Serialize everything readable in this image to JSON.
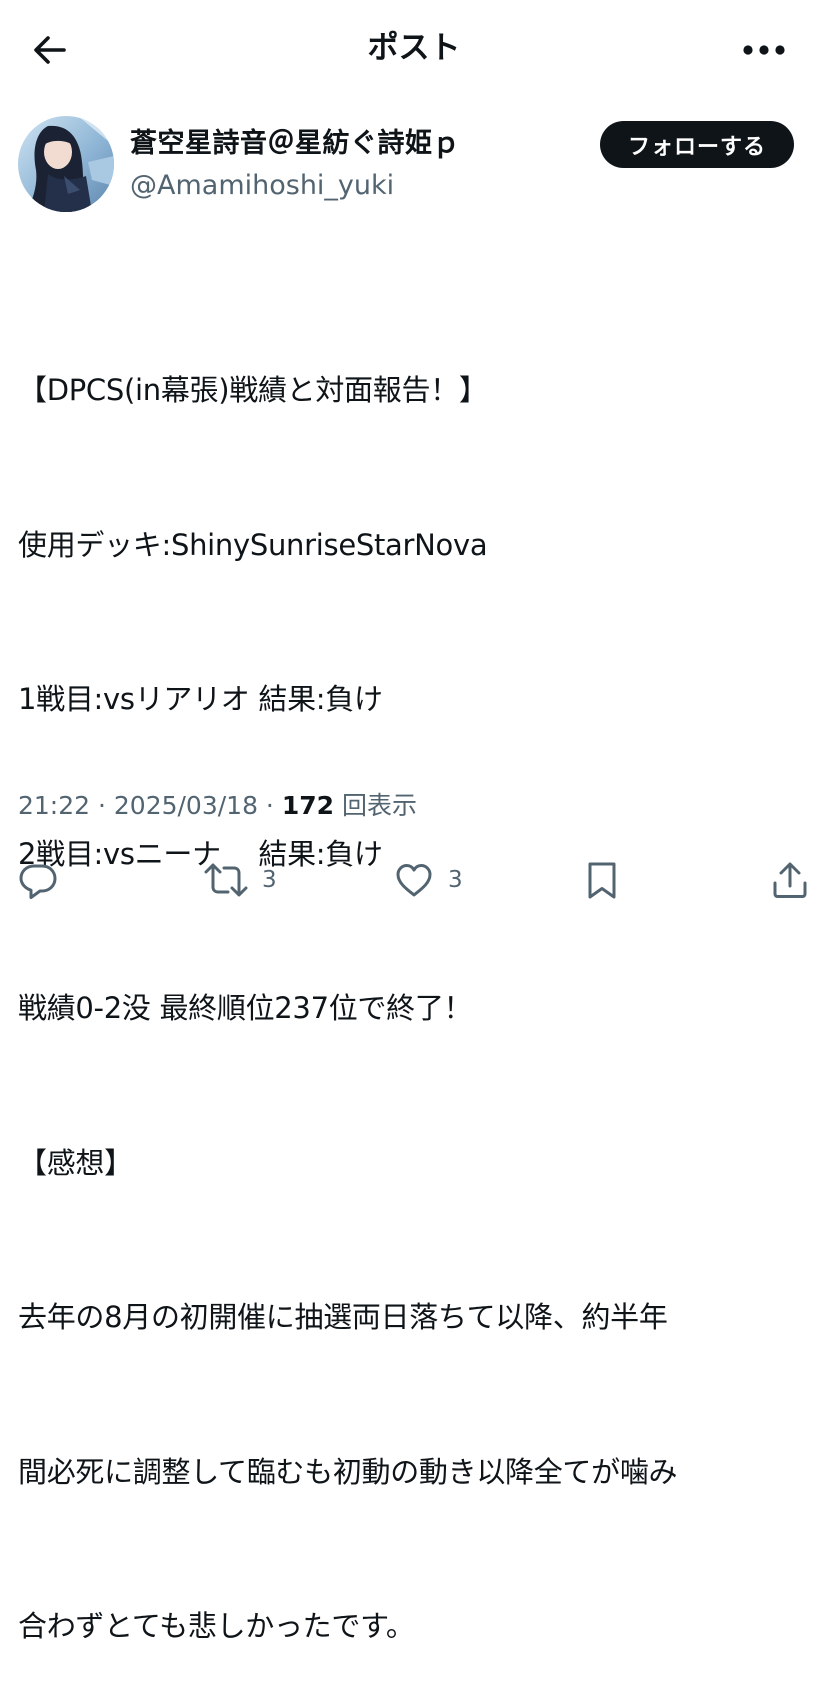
{
  "header": {
    "title": "ポスト",
    "back_icon": "arrow-left-icon",
    "more_icon": "more-horizontal-icon"
  },
  "author": {
    "display_name": "蒼空星詩音＠星紡ぐ詩姫ｐ",
    "handle": "@Amamihoshi_yuki",
    "follow_label": "フォローする"
  },
  "post": {
    "lines": [
      "【DPCS(in幕張)戦績と対面報告！】",
      "使用デッキ:ShinySunriseStarNova",
      "1戦目:vsリアリオ 結果:負け",
      "2戦目:vsニーナ　 結果:負け",
      "戦績0-2没 最終順位237位で終了！",
      "【感想】",
      "去年の8月の初開催に抽選両日落ちて以降、約半年",
      "間必死に調整して臨むも初動の動き以降全てが噛み",
      "合わずとても悲しかったです。"
    ]
  },
  "meta": {
    "time": "21:22",
    "separator": " · ",
    "date": "2025/03/18",
    "views_count": "172",
    "views_label": "回表示"
  },
  "actions": {
    "reply_count": "",
    "repost_count": "3",
    "like_count": "3"
  },
  "colors": {
    "text": "#0f1419",
    "secondary": "#536471",
    "button_bg": "#0f1419",
    "background": "#ffffff"
  }
}
